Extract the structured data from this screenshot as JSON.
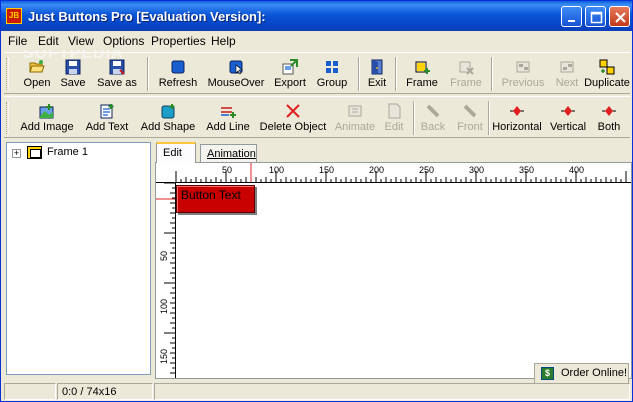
{
  "window": {
    "title": "Just Buttons Pro [Evaluation Version]:",
    "app_icon": "JB"
  },
  "watermark": "SOFTPEDIA",
  "menu": [
    "File",
    "Edit",
    "View",
    "Options",
    "Properties",
    "Help"
  ],
  "toolbar1": [
    {
      "label": "Open",
      "icon": "open-folder-icon",
      "enabled": true
    },
    {
      "label": "Save",
      "icon": "floppy-icon",
      "enabled": true
    },
    {
      "label": "Save as",
      "icon": "floppy-as-icon",
      "enabled": true
    },
    {
      "label": "Refresh",
      "icon": "refresh-icon",
      "enabled": true
    },
    {
      "label": "MouseOver",
      "icon": "mouseover-icon",
      "enabled": true
    },
    {
      "label": "Export",
      "icon": "export-icon",
      "enabled": true
    },
    {
      "label": "Group",
      "icon": "group-icon",
      "enabled": true
    },
    {
      "label": "Exit",
      "icon": "exit-door-icon",
      "enabled": true
    },
    {
      "label": "Frame",
      "icon": "add-frame-icon",
      "enabled": true
    },
    {
      "label": "Frame",
      "icon": "delete-frame-icon",
      "enabled": false
    },
    {
      "label": "Previous",
      "icon": "previous-icon",
      "enabled": false
    },
    {
      "label": "Next",
      "icon": "next-icon",
      "enabled": false
    },
    {
      "label": "Duplicate",
      "icon": "duplicate-icon",
      "enabled": true
    }
  ],
  "toolbar2": [
    {
      "label": "Add Image",
      "icon": "add-image-icon",
      "enabled": true
    },
    {
      "label": "Add Text",
      "icon": "add-text-icon",
      "enabled": true
    },
    {
      "label": "Add Shape",
      "icon": "add-shape-icon",
      "enabled": true
    },
    {
      "label": "Add Line",
      "icon": "add-line-icon",
      "enabled": true
    },
    {
      "label": "Delete Object",
      "icon": "delete-x-icon",
      "enabled": true
    },
    {
      "label": "Animate",
      "icon": "animate-icon",
      "enabled": false
    },
    {
      "label": "Edit",
      "icon": "edit-icon",
      "enabled": false
    },
    {
      "label": "Back",
      "icon": "back-icon",
      "enabled": false
    },
    {
      "label": "Front",
      "icon": "front-icon",
      "enabled": false
    },
    {
      "label": "Horizontal",
      "icon": "horizontal-align-icon",
      "enabled": true
    },
    {
      "label": "Vertical",
      "icon": "vertical-align-icon",
      "enabled": true
    },
    {
      "label": "Both",
      "icon": "both-align-icon",
      "enabled": true
    }
  ],
  "tree": {
    "items": [
      {
        "label": "Frame 1"
      }
    ]
  },
  "tabs": [
    {
      "label": "Edit",
      "active": true
    },
    {
      "label": "Animation",
      "active": false
    }
  ],
  "ruler": {
    "h_labels": [
      "50",
      "100",
      "150",
      "200",
      "250",
      "300",
      "350",
      "400"
    ],
    "v_labels": [
      "50",
      "100",
      "150"
    ]
  },
  "canvas": {
    "button_text": "Button Text",
    "button_color": "#c80000"
  },
  "order_button": {
    "label": "Order Online!",
    "icon": "dollar-icon"
  },
  "status": {
    "coords": "0:0 / 74x16"
  }
}
